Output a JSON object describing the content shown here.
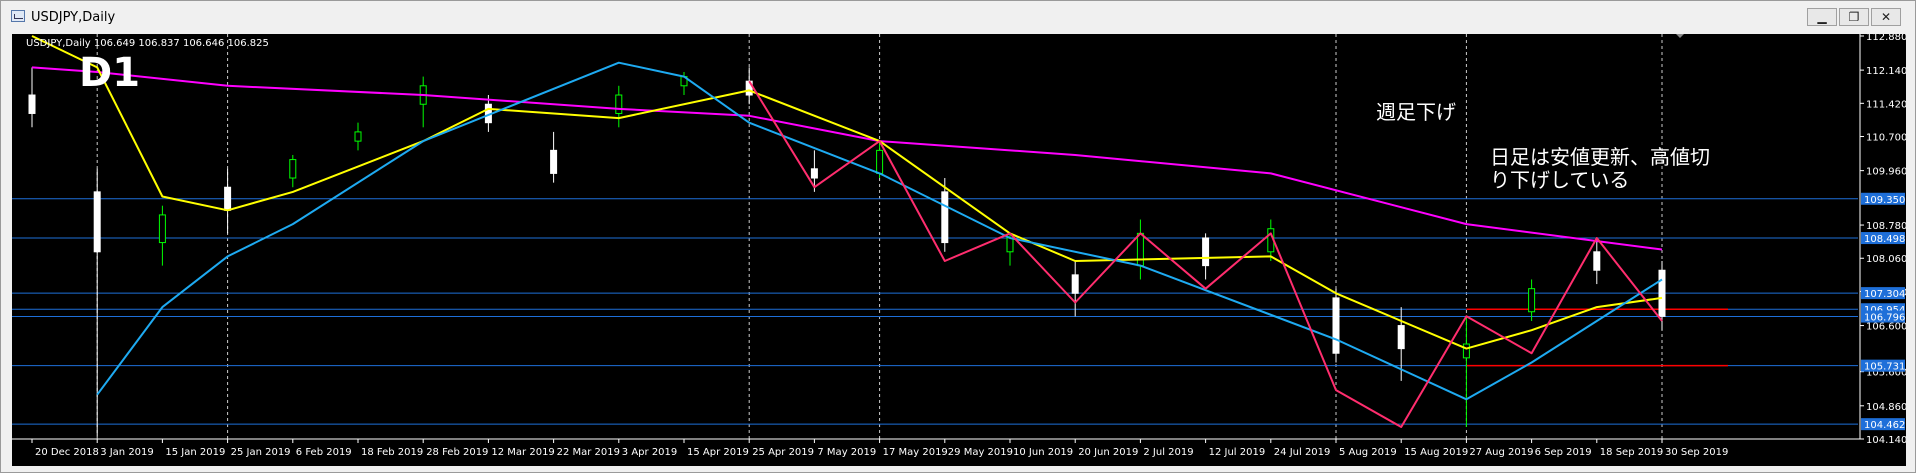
{
  "window": {
    "title": "USDJPY,Daily",
    "minimize_glyph": "▁",
    "maximize_glyph": "❐",
    "close_glyph": "✕"
  },
  "chart_data": {
    "type": "candlestick",
    "symbol_line": "USDJPY,Daily  106.649 106.837 106.646 106.825",
    "timeframe_badge": "D1",
    "annotation_weekly": "週足下げ",
    "annotation_daily_line1": "日足は安値更新、高値切",
    "annotation_daily_line2": "り下げしている",
    "ylim": [
      104.14,
      112.88
    ],
    "y_ticks": [
      "112.880",
      "112.140",
      "111.420",
      "110.700",
      "109.960",
      "108.780",
      "108.060",
      "107.340",
      "106.600",
      "105.600",
      "104.860",
      "104.140"
    ],
    "price_labels": [
      {
        "value": 109.35,
        "text": "109.350"
      },
      {
        "value": 108.498,
        "text": "108.498"
      },
      {
        "value": 107.304,
        "text": "107.304"
      },
      {
        "value": 106.954,
        "text": "106.954"
      },
      {
        "value": 106.796,
        "text": "106.796"
      },
      {
        "value": 105.731,
        "text": "105.731"
      },
      {
        "value": 104.462,
        "text": "104.462"
      }
    ],
    "x_labels": [
      "20 Dec 2018",
      "3 Jan 2019",
      "15 Jan 2019",
      "25 Jan 2019",
      "6 Feb 2019",
      "18 Feb 2019",
      "28 Feb 2019",
      "12 Mar 2019",
      "22 Mar 2019",
      "3 Apr 2019",
      "15 Apr 2019",
      "25 Apr 2019",
      "7 May 2019",
      "17 May 2019",
      "29 May 2019",
      "10 Jun 2019",
      "20 Jun 2019",
      "2 Jul 2019",
      "12 Jul 2019",
      "24 Jul 2019",
      "5 Aug 2019",
      "15 Aug 2019",
      "27 Aug 2019",
      "6 Sep 2019",
      "18 Sep 2019",
      "30 Sep 2019"
    ],
    "vertical_dashed_at": [
      "3 Jan 2019",
      "25 Jan 2019",
      "25 Apr 2019",
      "17 May 2019",
      "5 Aug 2019",
      "27 Aug 2019",
      "30 Sep 2019"
    ],
    "horizontal_levels": [
      109.35,
      108.498,
      107.304,
      106.954,
      106.796,
      105.731,
      104.462
    ],
    "red_levels": [
      {
        "value": 106.954,
        "from": "27 Aug 2019",
        "to_end": true
      },
      {
        "value": 105.731,
        "from": "27 Aug 2019",
        "to_end": true
      }
    ],
    "series": [
      {
        "name": "",
        "color": "#ff00ff",
        "x": [
          "20 Dec 2018",
          "3 Jan 2019",
          "25 Jan 2019",
          "28 Feb 2019",
          "3 Apr 2019",
          "25 Apr 2019",
          "17 May 2019",
          "20 Jun 2019",
          "24 Jul 2019",
          "27 Aug 2019",
          "30 Sep 2019"
        ],
        "y": [
          112.2,
          112.1,
          111.8,
          111.6,
          111.3,
          111.15,
          110.6,
          110.3,
          109.9,
          108.8,
          108.25
        ]
      },
      {
        "name": "",
        "color": "#ffff00",
        "x": [
          "20 Dec 2018",
          "3 Jan 2019",
          "15 Jan 2019",
          "25 Jan 2019",
          "6 Feb 2019",
          "28 Feb 2019",
          "12 Mar 2019",
          "3 Apr 2019",
          "25 Apr 2019",
          "17 May 2019",
          "10 Jun 2019",
          "20 Jun 2019",
          "24 Jul 2019",
          "5 Aug 2019",
          "27 Aug 2019",
          "6 Sep 2019",
          "18 Sep 2019",
          "30 Sep 2019"
        ],
        "y": [
          112.88,
          112.2,
          109.4,
          109.1,
          109.5,
          110.6,
          111.3,
          111.1,
          111.7,
          110.6,
          108.6,
          108.0,
          108.1,
          107.3,
          106.1,
          106.5,
          107.0,
          107.2
        ]
      },
      {
        "name": "",
        "color": "#1eaaf1",
        "x": [
          "3 Jan 2019",
          "15 Jan 2019",
          "25 Jan 2019",
          "6 Feb 2019",
          "28 Feb 2019",
          "3 Apr 2019",
          "15 Apr 2019",
          "25 Apr 2019",
          "17 May 2019",
          "10 Jun 2019",
          "2 Jul 2019",
          "5 Aug 2019",
          "27 Aug 2019",
          "6 Sep 2019",
          "18 Sep 2019",
          "30 Sep 2019"
        ],
        "y": [
          105.1,
          107.0,
          108.1,
          108.8,
          110.6,
          112.3,
          112.0,
          111.0,
          109.9,
          108.5,
          107.9,
          106.3,
          105.0,
          105.8,
          106.7,
          107.6
        ]
      },
      {
        "name": "",
        "color": "#ff2d6e",
        "x": [
          "25 Apr 2019",
          "7 May 2019",
          "17 May 2019",
          "29 May 2019",
          "10 Jun 2019",
          "20 Jun 2019",
          "2 Jul 2019",
          "12 Jul 2019",
          "24 Jul 2019",
          "5 Aug 2019",
          "15 Aug 2019",
          "27 Aug 2019",
          "6 Sep 2019",
          "18 Sep 2019",
          "30 Sep 2019"
        ],
        "y": [
          111.9,
          109.6,
          110.6,
          108.0,
          108.6,
          107.1,
          108.6,
          107.4,
          108.6,
          105.2,
          104.4,
          106.8,
          106.0,
          108.5,
          106.7
        ]
      }
    ],
    "candles": [
      {
        "x": "20 Dec 2018",
        "o": 111.6,
        "h": 112.2,
        "l": 110.9,
        "c": 111.2
      },
      {
        "x": "3 Jan 2019",
        "o": 109.5,
        "h": 110.0,
        "l": 104.2,
        "c": 108.2
      },
      {
        "x": "15 Jan 2019",
        "o": 108.4,
        "h": 109.2,
        "l": 107.9,
        "c": 109.0
      },
      {
        "x": "25 Jan 2019",
        "o": 109.6,
        "h": 110.0,
        "l": 108.6,
        "c": 109.1
      },
      {
        "x": "6 Feb 2019",
        "o": 109.8,
        "h": 110.3,
        "l": 109.6,
        "c": 110.2
      },
      {
        "x": "18 Feb 2019",
        "o": 110.6,
        "h": 111.0,
        "l": 110.4,
        "c": 110.8
      },
      {
        "x": "28 Feb 2019",
        "o": 111.4,
        "h": 112.0,
        "l": 110.9,
        "c": 111.8
      },
      {
        "x": "12 Mar 2019",
        "o": 111.4,
        "h": 111.6,
        "l": 110.8,
        "c": 111.0
      },
      {
        "x": "22 Mar 2019",
        "o": 110.4,
        "h": 110.8,
        "l": 109.7,
        "c": 109.9
      },
      {
        "x": "3 Apr 2019",
        "o": 111.2,
        "h": 111.8,
        "l": 110.9,
        "c": 111.6
      },
      {
        "x": "15 Apr 2019",
        "o": 111.8,
        "h": 112.1,
        "l": 111.6,
        "c": 112.0
      },
      {
        "x": "25 Apr 2019",
        "o": 111.9,
        "h": 112.2,
        "l": 111.4,
        "c": 111.6
      },
      {
        "x": "7 May 2019",
        "o": 110.0,
        "h": 110.4,
        "l": 109.5,
        "c": 109.8
      },
      {
        "x": "17 May 2019",
        "o": 109.9,
        "h": 110.6,
        "l": 109.8,
        "c": 110.4
      },
      {
        "x": "29 May 2019",
        "o": 109.5,
        "h": 109.8,
        "l": 108.2,
        "c": 108.4
      },
      {
        "x": "10 Jun 2019",
        "o": 108.2,
        "h": 108.6,
        "l": 107.9,
        "c": 108.5
      },
      {
        "x": "20 Jun 2019",
        "o": 107.7,
        "h": 108.0,
        "l": 106.8,
        "c": 107.3
      },
      {
        "x": "2 Jul 2019",
        "o": 107.9,
        "h": 108.9,
        "l": 107.6,
        "c": 108.6
      },
      {
        "x": "12 Jul 2019",
        "o": 108.5,
        "h": 108.6,
        "l": 107.6,
        "c": 107.9
      },
      {
        "x": "24 Jul 2019",
        "o": 108.2,
        "h": 108.9,
        "l": 108.0,
        "c": 108.7
      },
      {
        "x": "5 Aug 2019",
        "o": 107.2,
        "h": 107.4,
        "l": 105.8,
        "c": 106.0
      },
      {
        "x": "15 Aug 2019",
        "o": 106.6,
        "h": 107.0,
        "l": 105.4,
        "c": 106.1
      },
      {
        "x": "27 Aug 2019",
        "o": 105.9,
        "h": 106.8,
        "l": 104.4,
        "c": 106.2
      },
      {
        "x": "6 Sep 2019",
        "o": 106.9,
        "h": 107.6,
        "l": 106.7,
        "c": 107.4
      },
      {
        "x": "18 Sep 2019",
        "o": 108.2,
        "h": 108.5,
        "l": 107.5,
        "c": 107.8
      },
      {
        "x": "30 Sep 2019",
        "o": 107.8,
        "h": 108.0,
        "l": 106.5,
        "c": 106.8
      }
    ],
    "grid": false,
    "legend": "none",
    "colors": {
      "background": "#000000",
      "text": "#ffffff",
      "level_line": "#1e6fd9",
      "price_tag": "#1e6fd9",
      "red_level": "#ff0000",
      "candle": "#ffffff",
      "candle_up": "#00ff00"
    }
  }
}
